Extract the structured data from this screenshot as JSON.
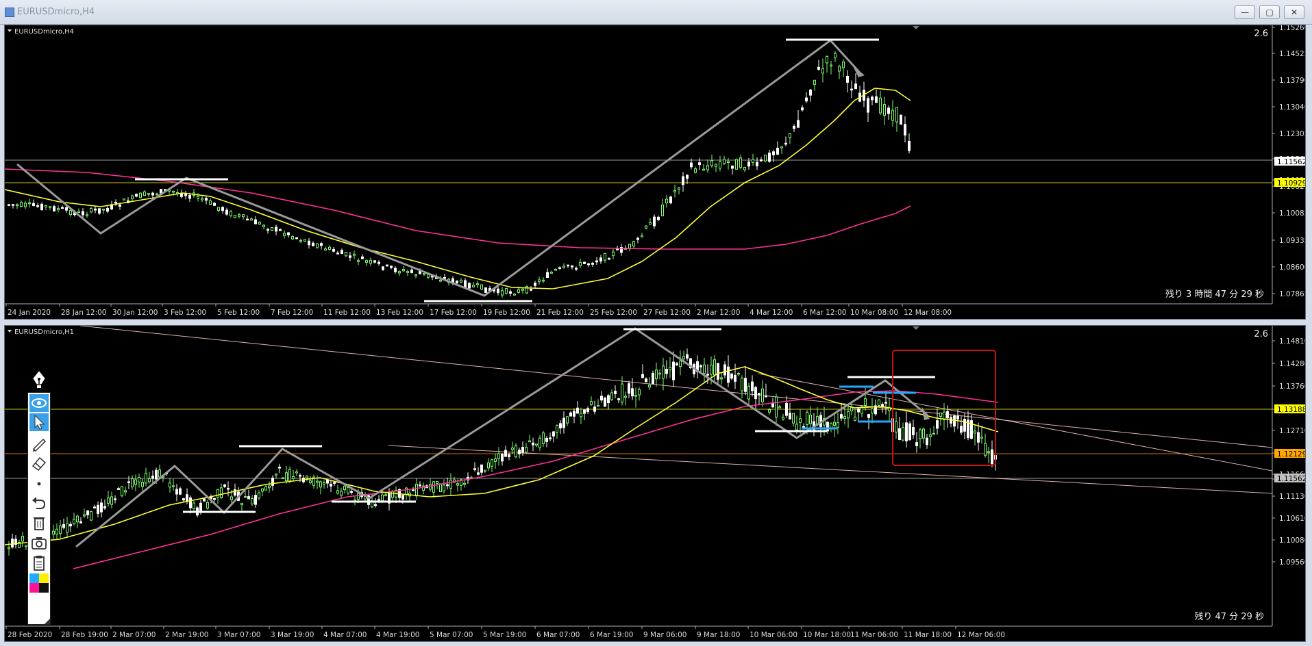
{
  "window": {
    "title": "EURUSDmicro,H4",
    "buttons": [
      "—",
      "▢",
      "✕"
    ]
  },
  "charts": [
    {
      "label": "EURUSDmicro,H4",
      "corner_value": "2.6",
      "price_axis": [
        "1.15260",
        "1.14525",
        "1.13790",
        "1.13040",
        "1.12305",
        "1.11562",
        "1.10929",
        "1.10820",
        "1.10085",
        "1.09335",
        "1.08600",
        "1.07865"
      ],
      "price_tags": [
        {
          "text": "1.11562",
          "color": "#ffffff"
        },
        {
          "text": "1.10929",
          "color": "#ffff00"
        }
      ],
      "time_axis": [
        "24 Jan 2020",
        "28 Jan 12:00",
        "30 Jan 12:00",
        "3 Feb 12:00",
        "5 Feb 12:00",
        "7 Feb 12:00",
        "11 Feb 12:00",
        "13 Feb 12:00",
        "17 Feb 12:00",
        "19 Feb 12:00",
        "21 Feb 12:00",
        "25 Feb 12:00",
        "27 Feb 12:00",
        "2 Mar 12:00",
        "4 Mar 12:00",
        "6 Mar 12:00",
        "10 Mar 08:00",
        "12 Mar 08:00"
      ],
      "countdown": "残り 3 時間 47 分 29 秒",
      "colors": {
        "bull": "#7cff6b",
        "bear": "#ffffff",
        "ma_fast": "#ffff33",
        "ma_slow": "#ff3399",
        "line": "#9a9a9a"
      }
    },
    {
      "label": "EURUSDmicro,H1",
      "corner_value": "2.6",
      "price_axis": [
        "1.14810",
        "1.14280",
        "1.13760",
        "1.13188",
        "1.12710",
        "1.12129",
        "1.11660",
        "1.11562",
        "1.11130",
        "1.10610",
        "1.10080",
        "1.09560"
      ],
      "price_tags": [
        {
          "text": "1.13188",
          "color": "#ffff00"
        },
        {
          "text": "1.12129",
          "color": "#ffa500"
        },
        {
          "text": "1.11562",
          "color": "#c0c0c0"
        }
      ],
      "time_axis": [
        "28 Feb 2020",
        "28 Feb 19:00",
        "2 Mar 07:00",
        "2 Mar 19:00",
        "3 Mar 07:00",
        "3 Mar 19:00",
        "4 Mar 07:00",
        "4 Mar 19:00",
        "5 Mar 07:00",
        "5 Mar 19:00",
        "6 Mar 07:00",
        "6 Mar 19:00",
        "9 Mar 06:00",
        "9 Mar 18:00",
        "10 Mar 06:00",
        "10 Mar 18:00",
        "11 Mar 06:00",
        "11 Mar 18:00",
        "12 Mar 06:00"
      ],
      "countdown": "残り 47 分 29 秒",
      "colors": {
        "bull": "#7cff6b",
        "bear": "#ffffff",
        "ma_fast": "#ffff33",
        "ma_slow": "#ff3399",
        "line": "#9a9a9a",
        "box": "#cc1111",
        "cyan": "#22aaff"
      }
    }
  ],
  "toolbox": {
    "tools": [
      "eye-icon",
      "cursor-icon",
      "pencil-icon",
      "eraser-icon",
      "dot-icon",
      "undo-icon",
      "trash-icon",
      "camera-icon",
      "clipboard-icon",
      "palette-icon"
    ]
  }
}
